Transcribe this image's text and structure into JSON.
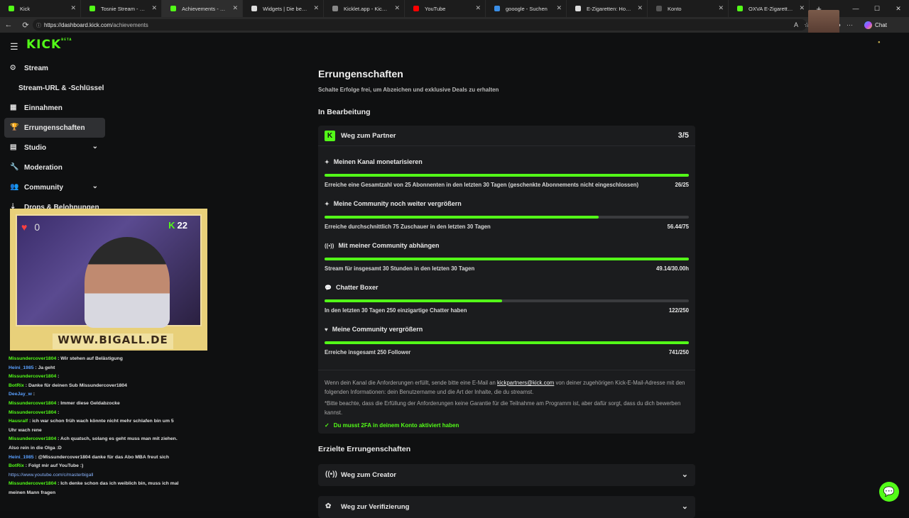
{
  "browser": {
    "tabs": [
      {
        "title": "Kick",
        "color": "#53fc18"
      },
      {
        "title": "Tosnie Stream - Watch Live",
        "color": "#53fc18"
      },
      {
        "title": "Achievements - Kick Dash",
        "color": "#53fc18"
      },
      {
        "title": "Widgets | Die beste Softw",
        "color": "#dddddd"
      },
      {
        "title": "Kicklet.app - Kick Chatbo",
        "color": "#888888"
      },
      {
        "title": "YouTube",
        "color": "#ff0000"
      },
      {
        "title": "gooogle - Suchen",
        "color": "#3a8ee6"
      },
      {
        "title": "E-Zigaretten: Hochwertige",
        "color": "#dddddd"
      },
      {
        "title": "Konto",
        "color": "#555555"
      },
      {
        "title": "OXVA E-Zigaretten POD",
        "color": "#53fc18"
      }
    ],
    "new_tab": "+",
    "url_host": "https://dashboard.kick.com",
    "url_path": "/achievements",
    "chat_label": "Chat",
    "back": "←",
    "reload": "⟳",
    "info": "ⓘ",
    "minimize": "—",
    "maximize": "☐",
    "close": "✕",
    "more": "···"
  },
  "brand": {
    "logo": "KICK",
    "logo_sup": "BETA",
    "accent": "#53fc18"
  },
  "sidebar": {
    "items": [
      {
        "label": "Stream",
        "icon": "⊙"
      },
      {
        "label": "Stream-URL & -Schlüssel",
        "icon": ""
      },
      {
        "label": "Einnahmen",
        "icon": "▦"
      },
      {
        "label": "Errungenschaften",
        "icon": "🏆"
      },
      {
        "label": "Studio",
        "icon": "▤",
        "chevron": "⌄"
      },
      {
        "label": "Moderation",
        "icon": "🔧"
      },
      {
        "label": "Community",
        "icon": "👥",
        "chevron": "⌄"
      },
      {
        "label": "Drops & Belohnungen",
        "icon": "⇣"
      }
    ]
  },
  "overlay": {
    "heart_count": "0",
    "kick_count": "22",
    "kick_badge": "K",
    "banner": "WWW.BIGALL.DE"
  },
  "chat": [
    {
      "user": "Missundercover1804",
      "msg": ": Wir stehen auf Belästigung"
    },
    {
      "user": "Heini_1985",
      "msg": ": Ja geht"
    },
    {
      "user": "Missundercover1804",
      "msg": ":"
    },
    {
      "user": "BotRix",
      "msg": ": Danke für deinen Sub Missundercover1804"
    },
    {
      "user": "DeeJay_w",
      "msg": ":"
    },
    {
      "user": "Missundercover1804",
      "msg": ": Immer diese Geldabzocke"
    },
    {
      "user": "Missundercover1804",
      "msg": ":"
    },
    {
      "user": "Hausralf",
      "msg": ": ich war schon früh wach könnte nicht mehr schlafen bin um 5 Uhr wach rene"
    },
    {
      "user": "Missundercover1804",
      "msg": ": Ach quatsch, solang es geht muss man mit ziehen. Also rein in die Olga :D"
    },
    {
      "user": "Heini_1985",
      "msg": ": @Missundercover1804 danke für das Abo MBA freut sich"
    },
    {
      "user": "BotRix",
      "msg": ": Folgt mir auf YouTube :)",
      "link": "https://www.youtube.com/c/masterbigall"
    },
    {
      "user": "Missundercover1804",
      "msg": ": Ich denke schon das ich weiblich bin, muss ich mal meinen Mann fragen"
    }
  ],
  "main": {
    "title": "Errungenschaften",
    "subtitle": "Schalte Erfolge frei, um Abzeichen und exklusive Deals zu erhalten",
    "in_progress_heading": "In Bearbeitung",
    "card": {
      "title": "Weg zum Partner",
      "icon": "K",
      "count": "3/5",
      "goals": [
        {
          "title": "Meinen Kanal monetarisieren",
          "icon": "✦",
          "desc": "Erreiche eine Gesamtzahl von 25 Abonnenten in den letzten 30 Tagen (geschenkte Abonnements nicht eingeschlossen)",
          "value": "26/25",
          "progress": 1.0
        },
        {
          "title": "Meine Community noch weiter vergrößern",
          "icon": "✦",
          "desc": "Erreiche durchschnittlich 75 Zuschauer in den letzten 30 Tagen",
          "value": "56.44/75",
          "progress": 0.752
        },
        {
          "title": "Mit meiner Community abhängen",
          "icon": "((•))",
          "desc": "Stream für insgesamt 30 Stunden in den letzten 30 Tagen",
          "value": "49.14/30.00h",
          "progress": 1.0
        },
        {
          "title": "Chatter Boxer",
          "icon": "💬",
          "desc": "In den letzten 30 Tagen 250 einzigartige Chatter haben",
          "value": "122/250",
          "progress": 0.488
        },
        {
          "title": "Meine Community vergrößern",
          "icon": "♥",
          "desc": "Erreiche insgesamt 250 Follower",
          "value": "741/250",
          "progress": 1.0
        }
      ],
      "note_pre": "Wenn dein Kanal die Anforderungen erfüllt, sende bitte eine E-Mail an ",
      "note_mail": "kickpartners@kick.com",
      "note_post": " von deiner zugehörigen Kick-E-Mail-Adresse mit den folgenden Informationen: dein Benutzername und die Art der Inhalte, die du streamst.",
      "note2": "*Bitte beachte, dass die Erfüllung der Anforderungen keine Garantie für die Teilnahme am Programm ist, aber dafür sorgt, dass du dich bewerben kannst.",
      "check_icon": "✓",
      "check": "Du musst 2FA in deinem Konto aktiviert haben"
    },
    "achieved_heading": "Erzielte Errungenschaften",
    "achieved": [
      {
        "title": "Weg zum Creator",
        "icon": "((•))",
        "chevron": "⌄"
      },
      {
        "title": "Weg zur Verifizierung",
        "icon": "✿",
        "chevron": "⌄"
      }
    ]
  },
  "help_icon": "💬"
}
